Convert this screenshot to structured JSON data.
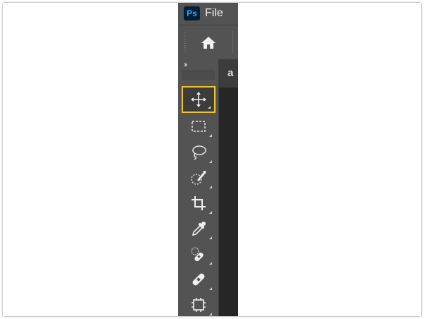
{
  "app": {
    "logo": "Ps",
    "menu": {
      "file_label": "File"
    },
    "doc_tab": {
      "label": "a"
    }
  },
  "colors": {
    "panel": "#535353",
    "dark_panel": "#424242",
    "canvas": "#262626",
    "highlight": "#f2c12e",
    "ps_logo_bg": "#001e36",
    "ps_logo_text": "#31a8ff"
  },
  "toolbar": {
    "collapse_icon": "double-chevron-right-icon",
    "tools": [
      {
        "name": "move-tool",
        "icon": "move-icon",
        "selected": true
      },
      {
        "name": "rectangular-marquee-tool",
        "icon": "rectangular-marquee-icon",
        "selected": false
      },
      {
        "name": "lasso-tool",
        "icon": "lasso-icon",
        "selected": false
      },
      {
        "name": "quick-selection-tool",
        "icon": "quick-selection-icon",
        "selected": false
      },
      {
        "name": "crop-tool",
        "icon": "crop-icon",
        "selected": false
      },
      {
        "name": "eyedropper-tool",
        "icon": "eyedropper-icon",
        "selected": false
      },
      {
        "name": "spot-healing-brush-tool",
        "icon": "spot-healing-icon",
        "selected": false
      },
      {
        "name": "healing-brush-tool",
        "icon": "bandage-icon",
        "selected": false
      },
      {
        "name": "artboard-tool",
        "icon": "artboard-icon",
        "selected": false
      }
    ]
  }
}
